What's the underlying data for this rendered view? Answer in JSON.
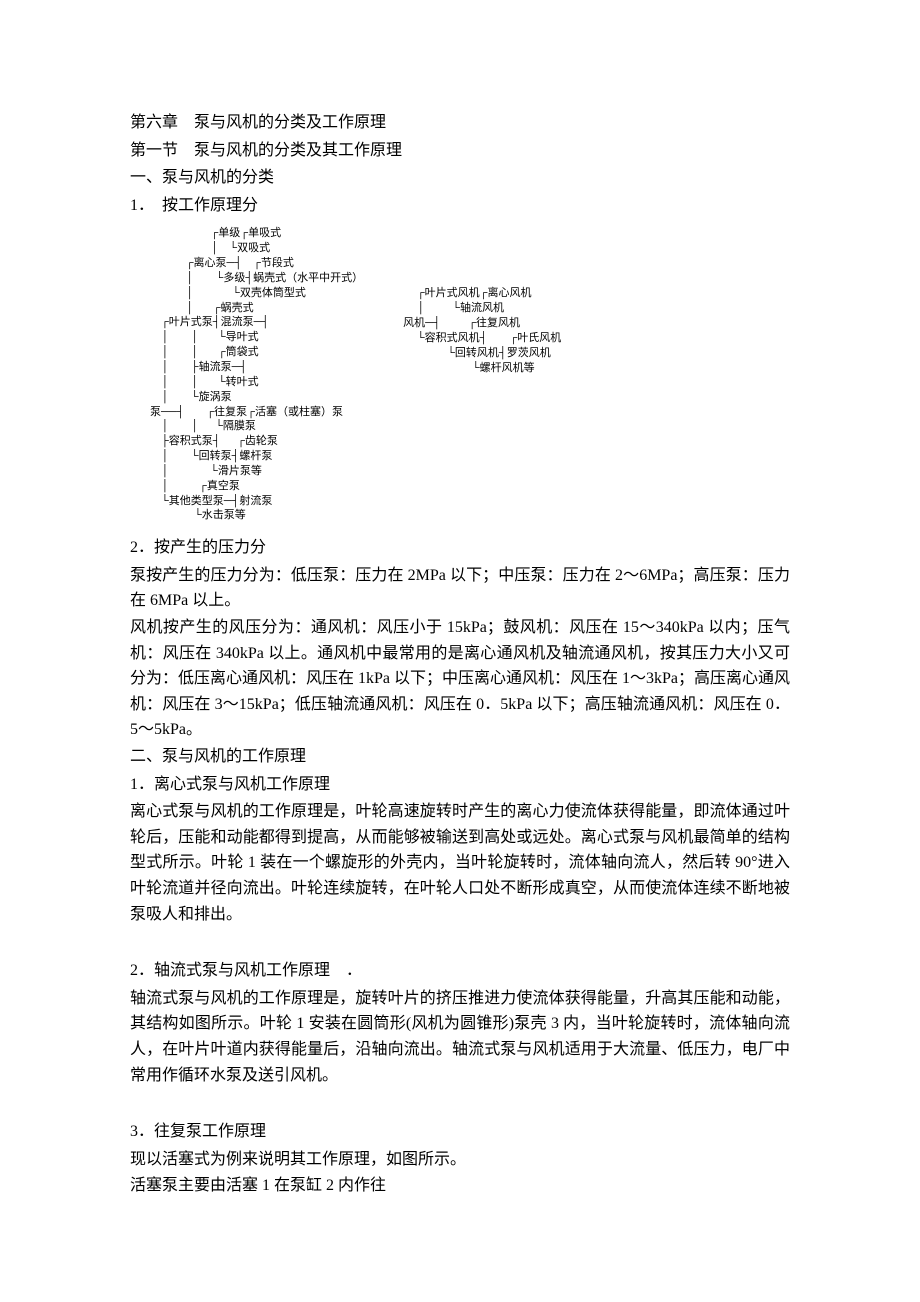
{
  "h1": "第六章　泵与风机的分类及工作原理",
  "h2": "第一节　泵与风机的分类及其工作原理",
  "h3_1": "一、泵与风机的分类",
  "h4_1": "1．　按工作原理分",
  "tree_pump": "                      ┌单级┌单吸式\n                      │    └双吸式\n             ┌离心泵─┤    ┌节段式\n             │        └多级┤蜗壳式（水平中开式）\n             │              └双壳体筒型式\n             │       ┌蜗壳式\n    ┌叶片式泵┤混流泵─┤\n    │        │       └导叶式\n    │        │       ┌筒袋式\n    │        ├轴流泵─┤\n    │        │       └转叶式\n    │        └旋涡泵\n泵──┤        ┌往复泵┌活塞（或柱塞）泵\n    │        │      └隔膜泵\n    ├容积式泵┤      ┌齿轮泵\n    │        └回转泵┤螺杆泵\n    │               └滑片泵等\n    │           ┌真空泵\n    └其他类型泵─┤射流泵\n                └水击泵等",
  "tree_fan": "     ┌叶片式风机┌离心风机\n     │          └轴流风机\n风机─┤          ┌往复风机\n     └容积式风机┤        ┌叶氏风机\n                └回转风机┤罗茨风机\n                         └螺杆风机等",
  "h4_2": "2．按产生的压力分",
  "p1": "泵按产生的压力分为：低压泵：压力在 2MPa 以下；中压泵：压力在 2～6MPa；高压泵：压力在 6MPa 以上。",
  "p2": "风机按产生的风压分为：通风机：风压小于 15kPa；鼓风机：风压在 15～340kPa 以内；压气机：风压在 340kPa 以上。通风机中最常用的是离心通风机及轴流通风机，按其压力大小又可分为：低压离心通风机：风压在 1kPa 以下；中压离心通风机：风压在 1～3kPa；高压离心通风机：风压在 3～15kPa；低压轴流通风机：风压在 0．5kPa 以下；高压轴流通风机：风压在 0．5～5kPa。",
  "h3_2": "二、泵与风机的工作原理",
  "h4_3": "1．离心式泵与风机工作原理",
  "p3": "离心式泵与风机的工作原理是，叶轮高速旋转时产生的离心力使流体获得能量，即流体通过叶轮后，压能和动能都得到提高，从而能够被输送到高处或远处。离心式泵与风机最简单的结构型式所示。叶轮 1 装在一个螺旋形的外壳内，当叶轮旋转时，流体轴向流人，然后转 90°进入叶轮流道并径向流出。叶轮连续旋转，在叶轮人口处不断形成真空，从而使流体连续不断地被泵吸人和排出。",
  "h4_4": "2．轴流式泵与风机工作原理　．",
  "p4": "轴流式泵与风机的工作原理是，旋转叶片的挤压推进力使流体获得能量，升高其压能和动能，其结构如图所示。叶轮 1 安装在圆筒形(风机为圆锥形)泵壳 3 内，当叶轮旋转时，流体轴向流人，在叶片叶道内获得能量后，沿轴向流出。轴流式泵与风机适用于大流量、低压力，电厂中常用作循环水泵及送引风机。",
  "h4_5": "3．往复泵工作原理",
  "p5": "现以活塞式为例来说明其工作原理，如图所示。",
  "p6": "活塞泵主要由活塞 1 在泵缸 2 内作往"
}
